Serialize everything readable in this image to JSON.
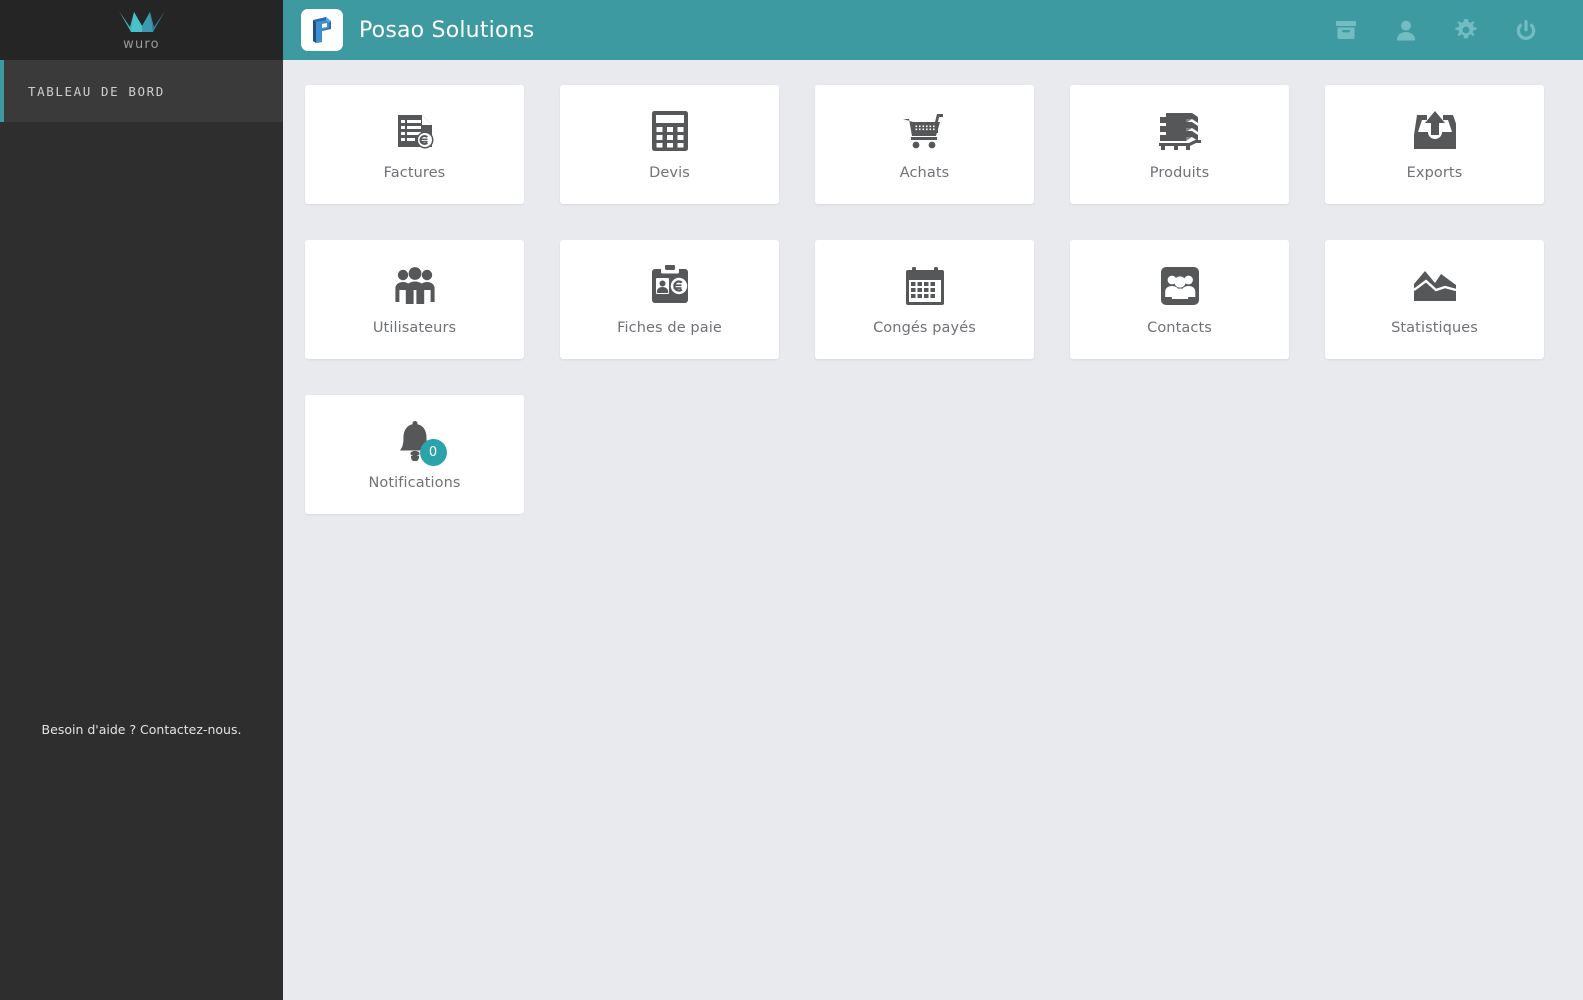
{
  "sidebar": {
    "brand": {
      "name": "wuro",
      "logo_icon": "wuro-crown-logo"
    },
    "items": [
      {
        "label": "TABLEAU DE BORD",
        "active": true
      }
    ],
    "help_text": "Besoin d'aide ? Contactez-nous."
  },
  "topbar": {
    "logo_icon": "posao-p-logo",
    "title": "Posao Solutions",
    "background_color": "#3d9aa1",
    "actions": [
      {
        "name": "archive-icon",
        "label": "Archive"
      },
      {
        "name": "user-icon",
        "label": "Utilisateur"
      },
      {
        "name": "gear-icon",
        "label": "Paramètres"
      },
      {
        "name": "power-icon",
        "label": "Déconnexion"
      }
    ]
  },
  "content": {
    "background_color": "#e8eaed",
    "accent_color": "#2ba3ab",
    "tiles": [
      {
        "label": "Factures",
        "icon": "invoice-euro-icon"
      },
      {
        "label": "Devis",
        "icon": "calculator-icon"
      },
      {
        "label": "Achats",
        "icon": "shopping-cart-icon"
      },
      {
        "label": "Produits",
        "icon": "pallet-stack-icon"
      },
      {
        "label": "Exports",
        "icon": "export-tray-icon"
      },
      {
        "label": "Utilisateurs",
        "icon": "users-group-icon"
      },
      {
        "label": "Fiches de paie",
        "icon": "clipboard-payslip-icon"
      },
      {
        "label": "Congés payés",
        "icon": "calendar-icon"
      },
      {
        "label": "Contacts",
        "icon": "contacts-card-icon"
      },
      {
        "label": "Statistiques",
        "icon": "area-chart-icon"
      },
      {
        "label": "Notifications",
        "icon": "bell-icon",
        "badge": "0"
      }
    ]
  }
}
